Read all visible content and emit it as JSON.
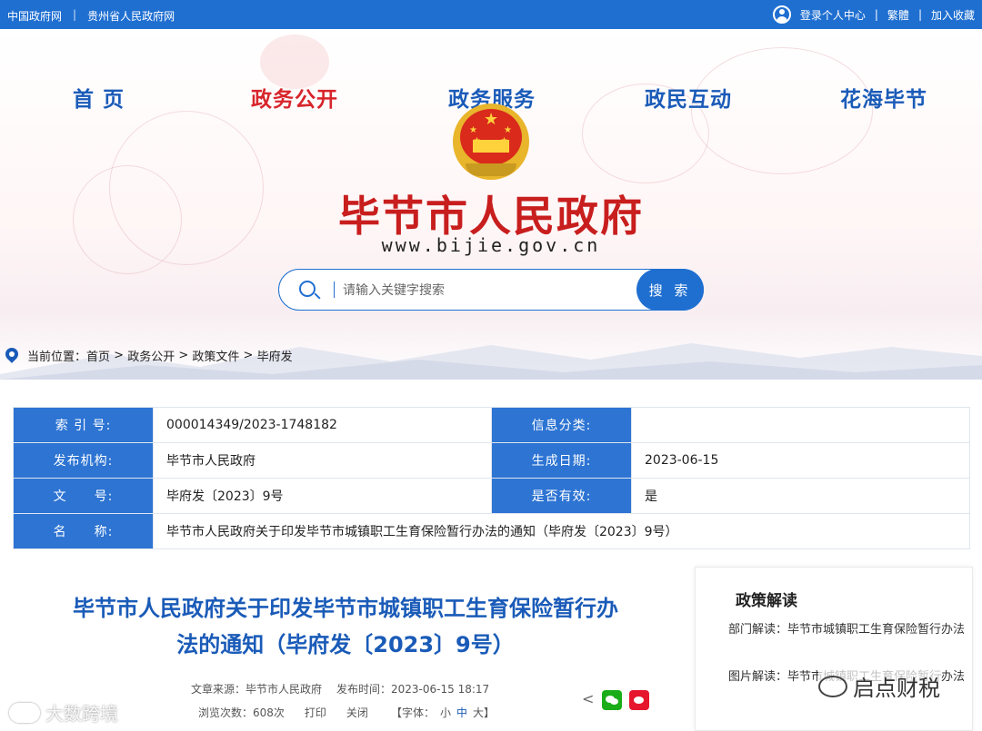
{
  "topbar": {
    "links": [
      "中国政府网",
      "贵州省人民政府网"
    ],
    "user_center": "登录个人中心",
    "traditional": "繁體",
    "favorite": "加入收藏"
  },
  "nav": {
    "items": [
      "首 页",
      "政务公开",
      "政务服务",
      "政民互动",
      "花海毕节"
    ],
    "active": "政务公开"
  },
  "site": {
    "title": "毕节市人民政府",
    "url": "www.bijie.gov.cn"
  },
  "search": {
    "placeholder": "请输入关键字搜索",
    "button": "搜 索"
  },
  "breadcrumb": {
    "prefix": "当前位置：",
    "items": [
      "首页",
      "政务公开",
      "政策文件",
      "毕府发"
    ]
  },
  "info": {
    "index_label": "索 引 号:",
    "index_value": "000014349/2023-1748182",
    "category_label": "信息分类:",
    "category_value": "",
    "publisher_label": "发布机构:",
    "publisher_value": "毕节市人民政府",
    "date_label": "生成日期:",
    "date_value": "2023-06-15",
    "docno_label": "文　　号:",
    "docno_value": "毕府发〔2023〕9号",
    "valid_label": "是否有效:",
    "valid_value": "是",
    "name_label": "名　　称:",
    "name_value": "毕节市人民政府关于印发毕节市城镇职工生育保险暂行办法的通知（毕府发〔2023〕9号）"
  },
  "article": {
    "title_line1": "毕节市人民政府关于印发毕节市城镇职工生育保险暂行办",
    "title_line2": "法的通知（毕府发〔2023〕9号）",
    "source": "文章来源：毕节市人民政府",
    "published": "发布时间：2023-06-15 18:17",
    "views": "浏览次数：608次",
    "print": "打印",
    "close": "关闭",
    "font_label": "【字体：",
    "font_small": "小",
    "font_mid": "中",
    "font_large": "大】"
  },
  "side": {
    "title": "政策解读",
    "item1": "部门解读：毕节市城镇职工生育保险暂行办法",
    "item2": "图片解读：毕节市城镇职工生育保险暂行办法"
  },
  "watermarks": {
    "left": "大数跨境",
    "right": "启点财税"
  },
  "colors": {
    "primary": "#1f6fd1",
    "title_red": "#c81e1e",
    "label_blue": "#2d74d3",
    "wechat_green": "#1aad19",
    "weibo_red": "#e6162d"
  },
  "icons": [
    "user-icon",
    "search-icon",
    "location-pin-icon",
    "share-icon",
    "wechat-icon",
    "weibo-icon",
    "national-emblem-icon"
  ]
}
